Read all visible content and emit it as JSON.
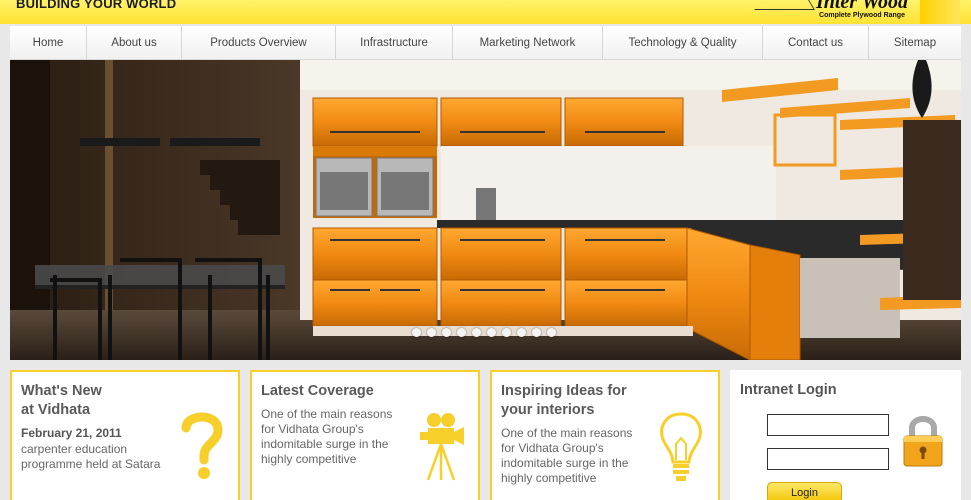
{
  "header": {
    "tagline": "BUILDING YOUR WORLD",
    "brand_name": "Inter Wood",
    "brand_subtitle": "Complete Plywood Range"
  },
  "nav": {
    "items": [
      {
        "label": "Home"
      },
      {
        "label": "About us"
      },
      {
        "label": "Products Overview"
      },
      {
        "label": "Infrastructure"
      },
      {
        "label": "Marketing Network"
      },
      {
        "label": "Technology & Quality"
      },
      {
        "label": "Contact us"
      },
      {
        "label": "Sitemap"
      }
    ]
  },
  "hero": {
    "slide_count": 10,
    "active_slide": 1
  },
  "boxes": {
    "whats_new": {
      "title_line1": "What's New",
      "title_line2": "at Vidhata",
      "date": "February 21, 2011",
      "text_line1": "carpenter education",
      "text_line2": "programme held at Satara"
    },
    "latest_coverage": {
      "title": "Latest Coverage",
      "text_line1": "One of the main reasons",
      "text_line2": "for Vidhata Group's",
      "text_line3": "indomitable surge in the",
      "text_line4": "highly competitive"
    },
    "inspiring_ideas": {
      "title_line1": "Inspiring Ideas for",
      "title_line2": "your interiors",
      "text_line1": "One of the main reasons",
      "text_line2": "for Vidhata Group's",
      "text_line3": "indomitable surge in the",
      "text_line4": "highly competitive"
    }
  },
  "login": {
    "title": "Intranet Login",
    "username_value": "",
    "password_value": "",
    "button_label": "Login"
  },
  "colors": {
    "accent_yellow": "#f7cf2a",
    "header_yellow": "#ffe233",
    "kitchen_orange": "#f08a12"
  }
}
